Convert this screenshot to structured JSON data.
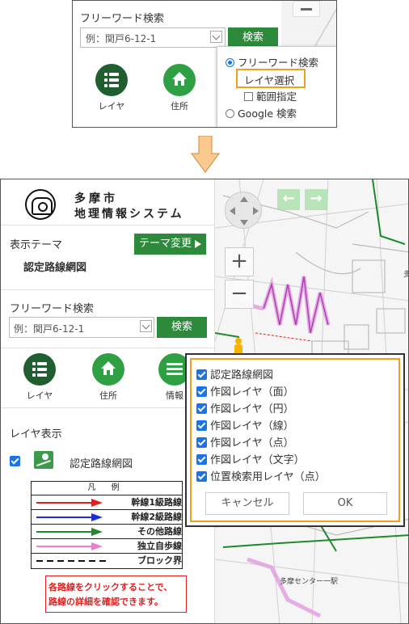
{
  "top_panel": {
    "freeword_label": "フリーワード検索",
    "search_placeholder": "例：関戸6-12-1",
    "search_button": "検索",
    "layer_label": "レイヤ",
    "address_label": "住所",
    "options": {
      "freeword_radio": "フリーワード検索",
      "layer_select": "レイヤ選択",
      "range_check": "範囲指定",
      "google_radio": "Google 検索"
    }
  },
  "bottom_panel": {
    "logo": {
      "line1": "多摩市",
      "line2": "地理情報システム"
    },
    "theme": {
      "label": "表示テーマ",
      "value": "認定路線網図",
      "change_button": "テーマ変更"
    },
    "search": {
      "label": "フリーワード検索",
      "placeholder": "例：関戸6-12-1",
      "button": "検索"
    },
    "tools": {
      "layer": "レイヤ",
      "address": "住所",
      "info": "情報"
    },
    "layer_display": {
      "label": "レイヤ表示",
      "layer_name": "認定路線網図"
    },
    "legend": {
      "header": "凡 例",
      "rows": [
        {
          "label": "幹線1級路線",
          "color": "#e02020",
          "style": "arrow"
        },
        {
          "label": "幹線2級路線",
          "color": "#1a2ee0",
          "style": "arrow"
        },
        {
          "label": "その他路線",
          "color": "#1e8a2a",
          "style": "arrow"
        },
        {
          "label": "独立自歩線",
          "color": "#f07ad8",
          "style": "arrow"
        },
        {
          "label": "ブロック界",
          "color": "#111111",
          "style": "dashed"
        }
      ]
    },
    "note": {
      "line1": "各路線をクリックすることで、",
      "line2": "路線の詳細を確認できます。"
    },
    "dialog": {
      "items": [
        "認定路線網図",
        "作図レイヤ（面）",
        "作図レイヤ（円）",
        "作図レイヤ（線）",
        "作図レイヤ（点）",
        "作図レイヤ（文字）",
        "位置検索用レイヤ（点）"
      ],
      "cancel": "キャンセル",
      "ok": "OK"
    },
    "map": {
      "labels": [
        "多",
        "多摩センター一駅"
      ],
      "zoom_in": "+",
      "zoom_out": "−"
    }
  },
  "colors": {
    "accent_green": "#2c8a3a",
    "highlight_orange": "#f0a020",
    "checkbox_blue": "#1a73e8",
    "note_red": "#e02020"
  }
}
